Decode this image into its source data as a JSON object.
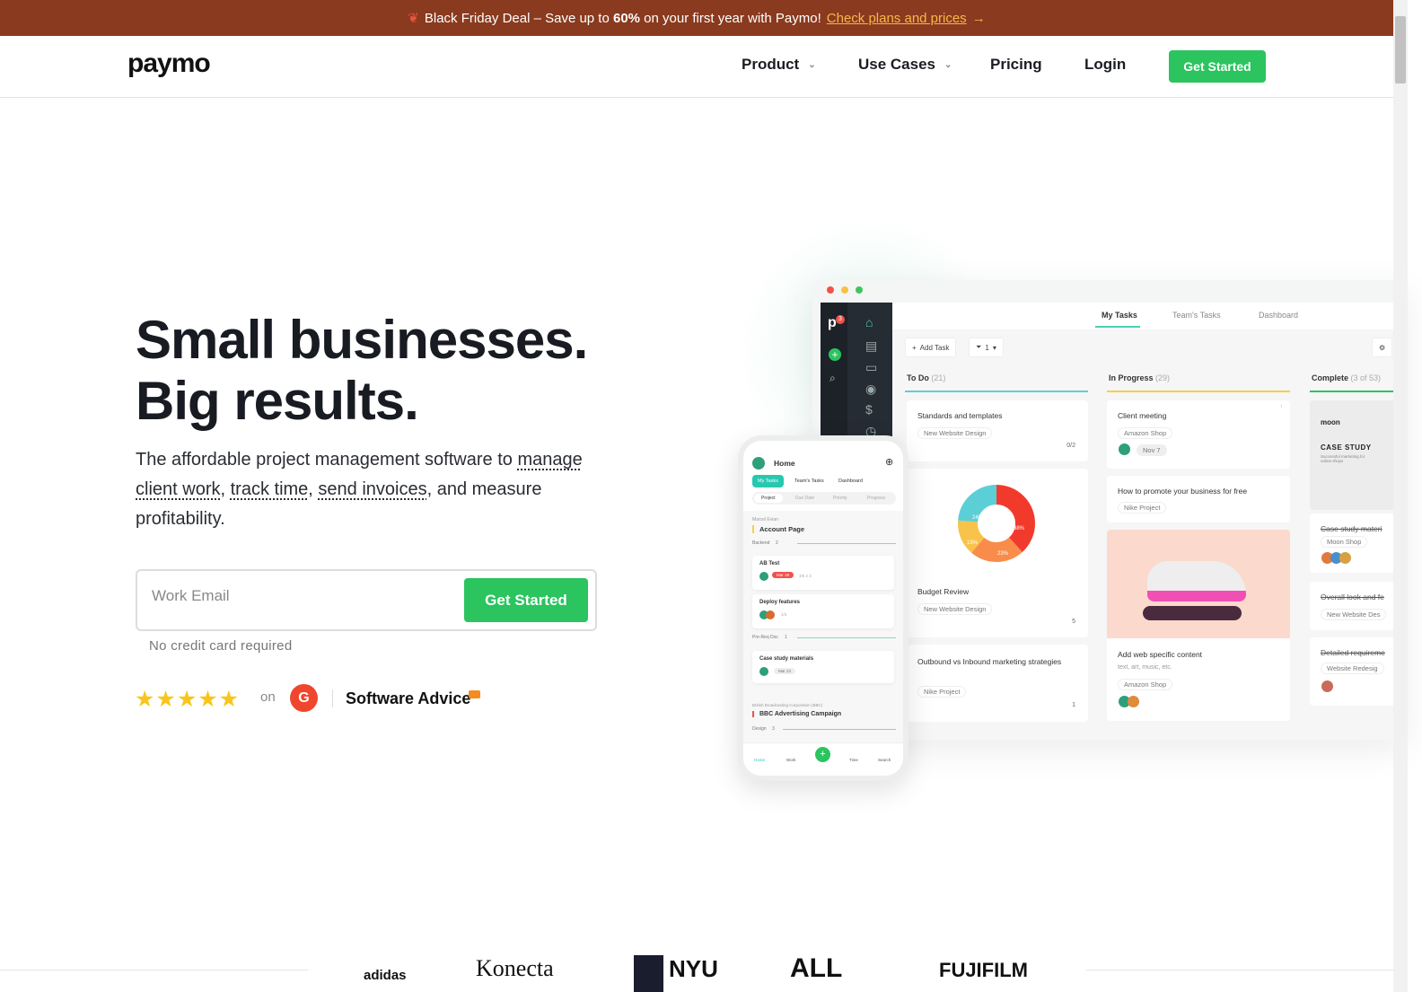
{
  "banner": {
    "icon": "leaf-icon",
    "text_before": "Black Friday Deal – Save up to ",
    "highlight": "60%",
    "text_after": " on your first year with Paymo!",
    "link": "Check plans and prices",
    "arrow": "→"
  },
  "nav": {
    "logo": "paymo",
    "items": [
      {
        "label": "Product",
        "has_dropdown": true
      },
      {
        "label": "Use Cases",
        "has_dropdown": true
      },
      {
        "label": "Pricing"
      },
      {
        "label": "Login"
      }
    ],
    "cta": "Get Started"
  },
  "hero": {
    "title_line1": "Small businesses.",
    "title_line2": "Big results.",
    "sub_1": "The affordable project management software to ",
    "link1": "manage client work",
    "sep1": ", ",
    "link2": "track time",
    "sep2": ", ",
    "link3": "send invoices",
    "sub_2": ", and measure profitability.",
    "email_placeholder": "Work Email",
    "cta": "Get Started",
    "note": "No credit card required",
    "rating": {
      "stars": 5,
      "on": "on",
      "g2": "G",
      "software_advice": "Software Advice"
    }
  },
  "app": {
    "badge": "3",
    "tabs": [
      "My Tasks",
      "Team's Tasks",
      "Dashboard"
    ],
    "add_task": "Add Task",
    "filter_count": "1",
    "columns": [
      {
        "name": "To Do",
        "count": "(21)",
        "color": "#5ccfd6"
      },
      {
        "name": "In Progress",
        "count": "(29)",
        "color": "#f5cf4a"
      },
      {
        "name": "Complete",
        "count": "(3 of 53)",
        "color": "#2bc45f"
      }
    ],
    "todo": [
      {
        "title": "Standards and templates",
        "project": "New Website Design",
        "meta": "0/2"
      },
      {
        "title": "Budget Review",
        "project": "New Website Design",
        "meta": "5",
        "chart": [
          "24%",
          "38%",
          "23%",
          "15%"
        ]
      },
      {
        "title": "Outbound vs Inbound marketing strategies",
        "project": "Nike Project",
        "meta": "1"
      }
    ],
    "inprogress": [
      {
        "title": "Client meeting",
        "project": "Amazon Shop",
        "date": "Nov 7"
      },
      {
        "title": "How to promote your business for free",
        "project": "Nike Project"
      },
      {
        "title": "Add web specific content",
        "desc": "text, art, music, etc.",
        "project": "Amazon Shop"
      }
    ],
    "complete": [
      {
        "brand": "moon",
        "heading": "CASE STUDY",
        "desc": "Successful marketing for online shops"
      },
      {
        "title": "Case study materi",
        "project": "Moon Shop"
      },
      {
        "title": "Overall look and fe",
        "project": "New Website Des"
      },
      {
        "title": "Detailed requireme",
        "project": "Website Redesig"
      }
    ]
  },
  "phone": {
    "title": "Home",
    "tabs": [
      "My Tasks",
      "Team's Tasks",
      "Dashboard"
    ],
    "sort": [
      "Project",
      "Due Date",
      "Priority",
      "Progress"
    ],
    "client1": "Marcel Evian",
    "project1": "Account Page",
    "group1": "Backend",
    "group1_count": "2",
    "tasks": [
      {
        "title": "AB Test",
        "date": "Mar 18",
        "meta": "3/5  2  3"
      },
      {
        "title": "Deploy features",
        "meta": "1/3"
      }
    ],
    "group2": "Pre-Req Doc",
    "group2_count": "1",
    "task3": "Case study materials",
    "task3_date": "Mar 23",
    "client2": "British Broadcasting Corporation (BBC)",
    "project2": "BBC Advertising Campaign",
    "group3": "Design",
    "group3_count": "3",
    "bottom": [
      "Home",
      "Work",
      "+",
      "Time",
      "Search"
    ]
  },
  "logos": [
    "adidas",
    "Konecta",
    "NYU",
    "ALL",
    "FUJIFILM"
  ],
  "colors": {
    "accent": "#2bc45f",
    "banner": "#8a3a1e",
    "link": "#f7b84a"
  }
}
